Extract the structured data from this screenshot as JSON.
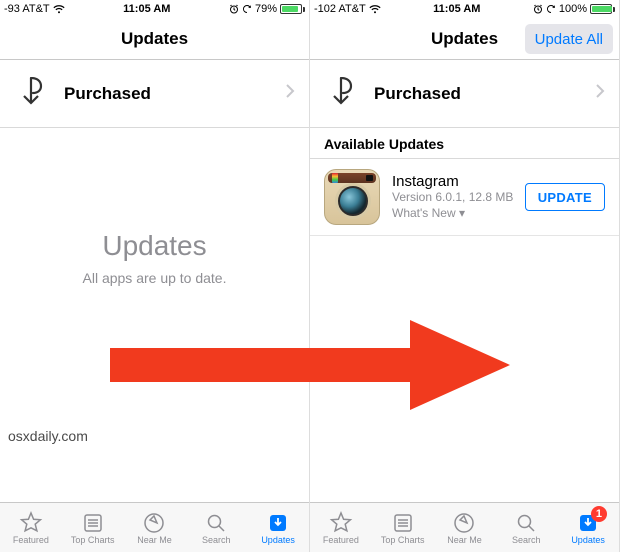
{
  "left": {
    "status": {
      "signal_text": "-93 AT&T",
      "time": "11:05 AM",
      "battery_pct": "79%",
      "battery_fill": "79"
    },
    "header": {
      "title": "Updates"
    },
    "purchased_label": "Purchased",
    "empty": {
      "title": "Updates",
      "sub": "All apps are up to date."
    },
    "tabs": {
      "featured": "Featured",
      "top_charts": "Top Charts",
      "near_me": "Near Me",
      "search": "Search",
      "updates": "Updates"
    },
    "watermark": "osxdaily.com"
  },
  "right": {
    "status": {
      "signal_text": "-102 AT&T",
      "time": "11:05 AM",
      "battery_pct": "100%",
      "battery_fill": "100"
    },
    "header": {
      "title": "Updates",
      "update_all": "Update All"
    },
    "purchased_label": "Purchased",
    "section": "Available Updates",
    "app": {
      "name": "Instagram",
      "sub": "Version 6.0.1, 12.8 MB",
      "whats_new": "What's New ▾",
      "update_btn": "UPDATE"
    },
    "tabs": {
      "featured": "Featured",
      "top_charts": "Top Charts",
      "near_me": "Near Me",
      "search": "Search",
      "updates": "Updates",
      "badge": "1"
    }
  }
}
